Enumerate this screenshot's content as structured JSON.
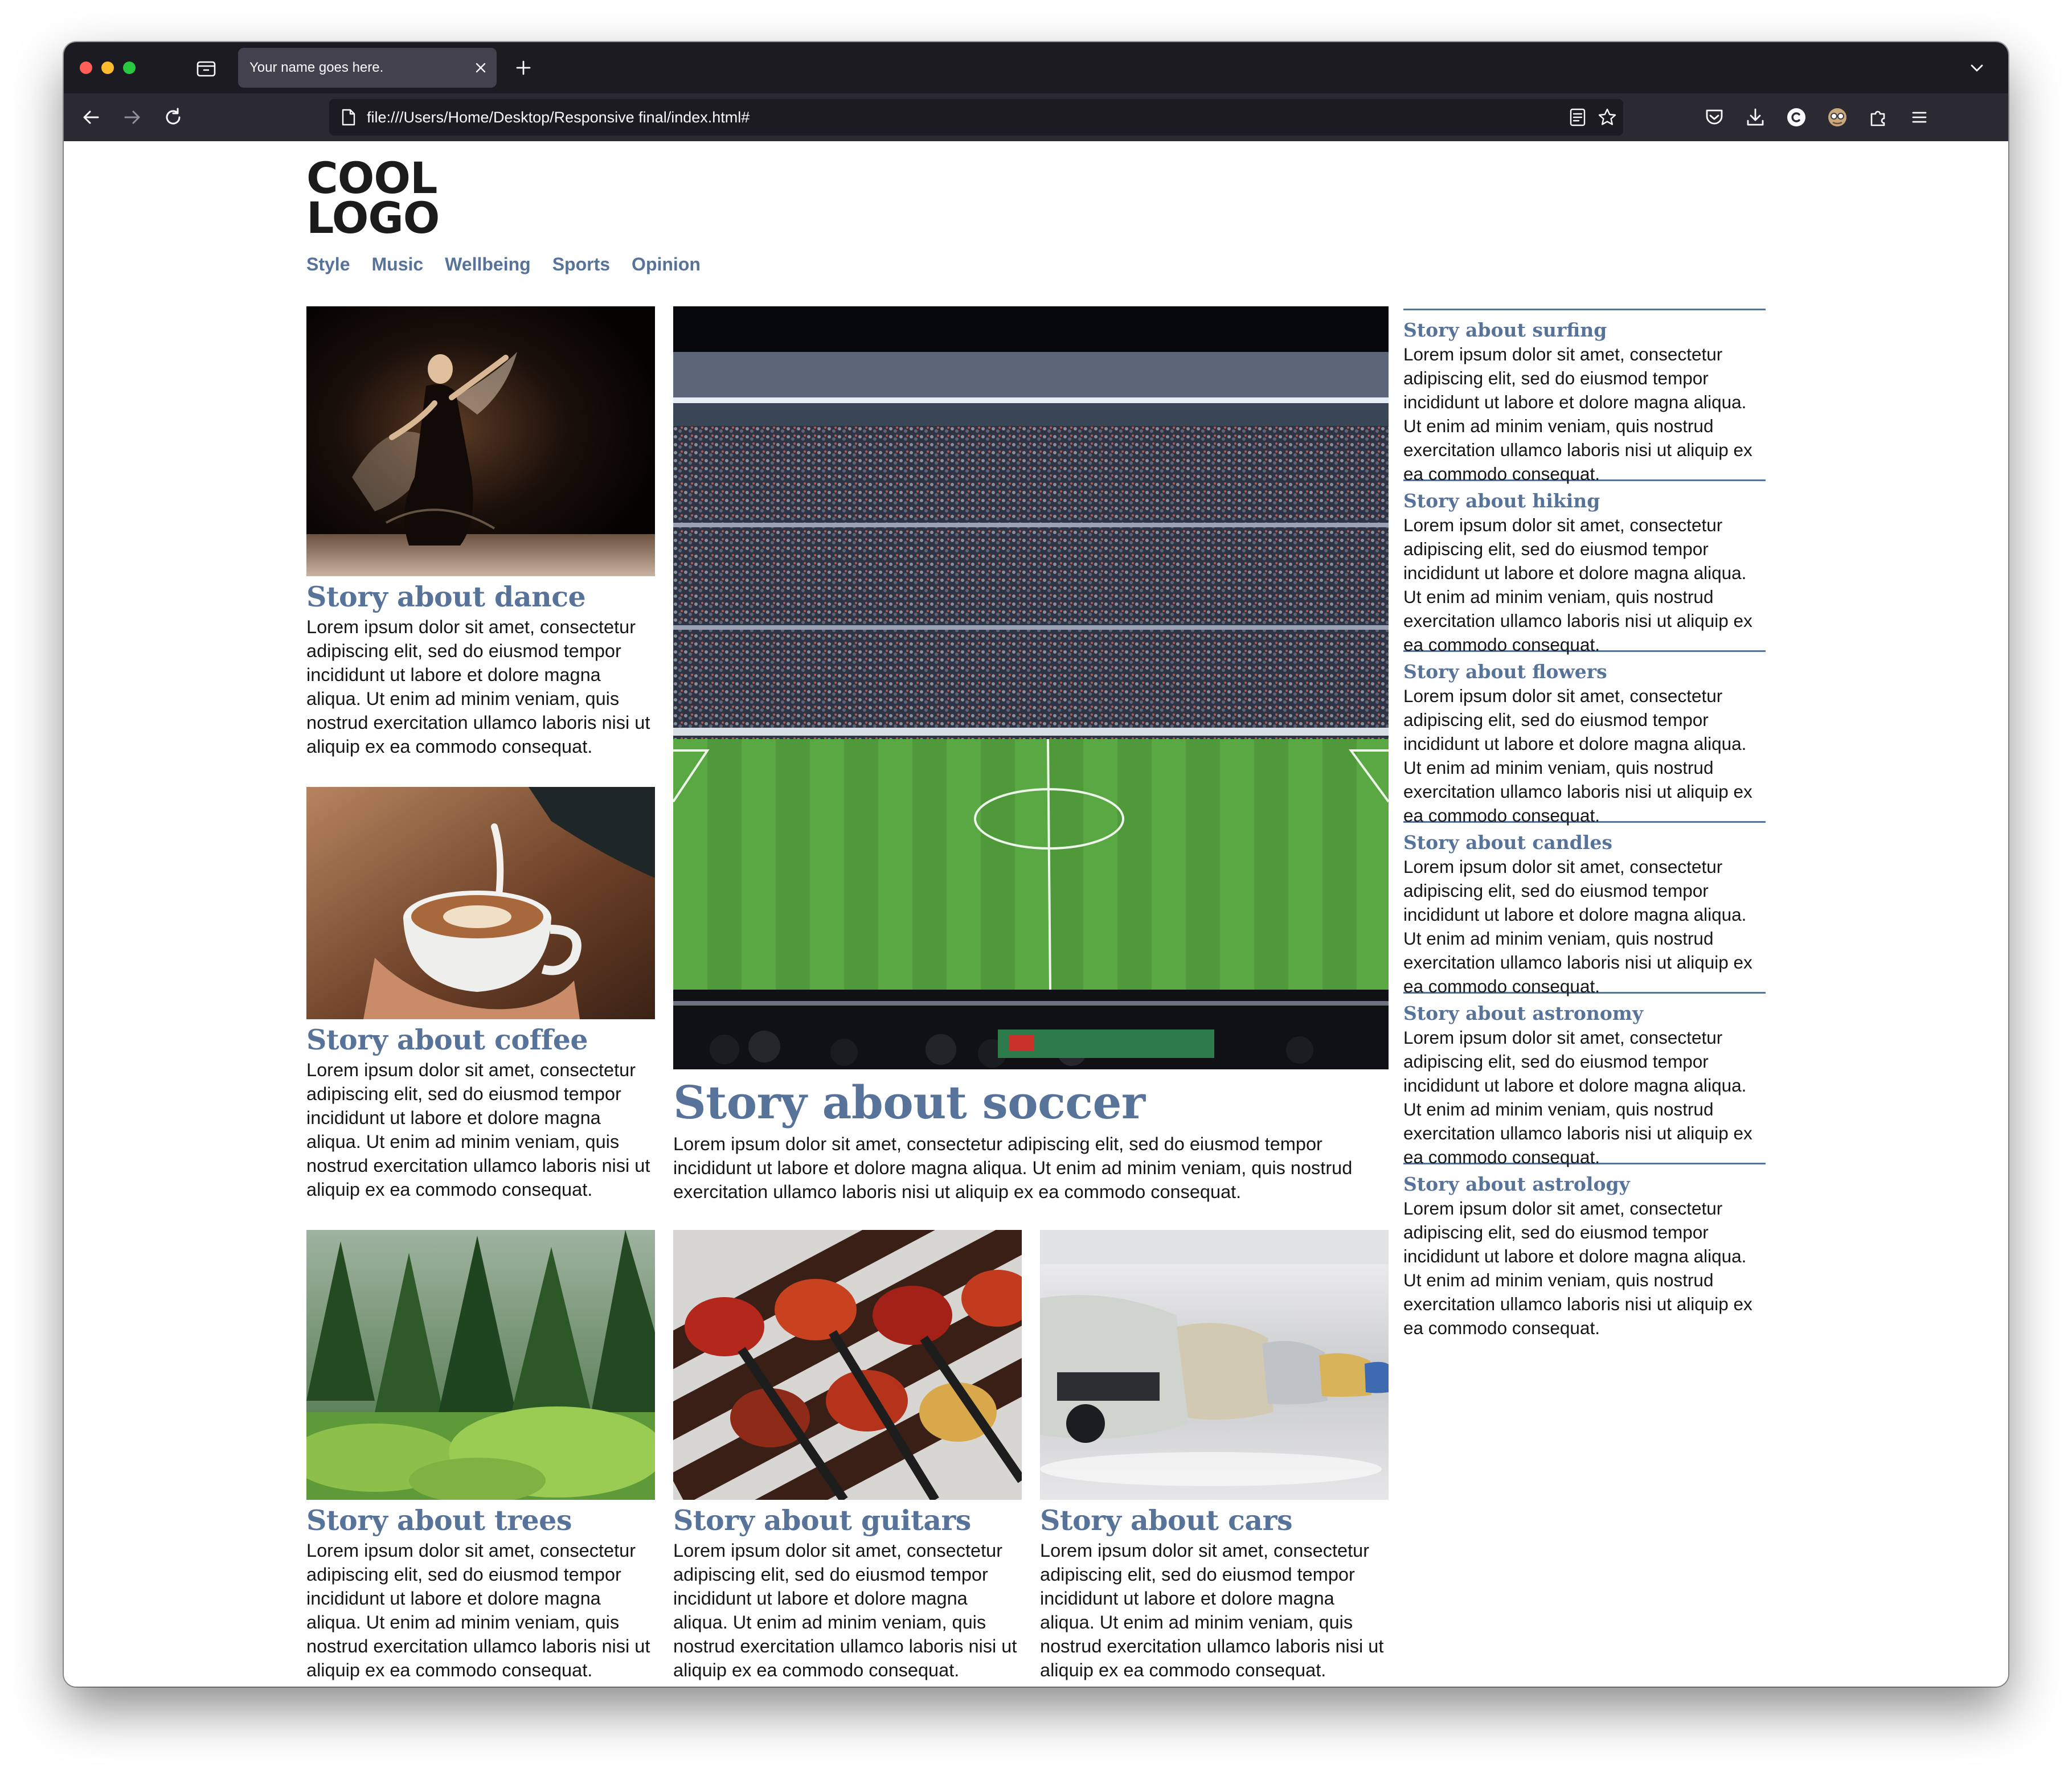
{
  "browser": {
    "tab_title": "Your name goes here.",
    "url": "file:///Users/Home/Desktop/Responsive final/index.html#"
  },
  "site": {
    "logo_line1": "COOL",
    "logo_line2": "LOGO",
    "nav": [
      "Style",
      "Music",
      "Wellbeing",
      "Sports",
      "Opinion"
    ]
  },
  "stories": {
    "dance": {
      "title": "Story about dance",
      "body": "Lorem ipsum dolor sit amet, consectetur adipiscing elit, sed do eiusmod tempor incididunt ut labore et dolore magna aliqua. Ut enim ad minim veniam, quis nostrud exercitation ullamco laboris nisi ut aliquip ex ea commodo consequat."
    },
    "coffee": {
      "title": "Story about coffee",
      "body": "Lorem ipsum dolor sit amet, consectetur adipiscing elit, sed do eiusmod tempor incididunt ut labore et dolore magna aliqua. Ut enim ad minim veniam, quis nostrud exercitation ullamco laboris nisi ut aliquip ex ea commodo consequat."
    },
    "soccer": {
      "title": "Story about soccer",
      "body": "Lorem ipsum dolor sit amet, consectetur adipiscing elit, sed do eiusmod tempor incididunt ut labore et dolore magna aliqua. Ut enim ad minim veniam, quis nostrud exercitation ullamco laboris nisi ut aliquip ex ea commodo consequat."
    },
    "trees": {
      "title": "Story about trees",
      "body": "Lorem ipsum dolor sit amet, consectetur adipiscing elit, sed do eiusmod tempor incididunt ut labore et dolore magna aliqua. Ut enim ad minim veniam, quis nostrud exercitation ullamco laboris nisi ut aliquip ex ea commodo consequat."
    },
    "guitars": {
      "title": "Story about guitars",
      "body": "Lorem ipsum dolor sit amet, consectetur adipiscing elit, sed do eiusmod tempor incididunt ut labore et dolore magna aliqua. Ut enim ad minim veniam, quis nostrud exercitation ullamco laboris nisi ut aliquip ex ea commodo consequat."
    },
    "cars": {
      "title": "Story about cars",
      "body": "Lorem ipsum dolor sit amet, consectetur adipiscing elit, sed do eiusmod tempor incididunt ut labore et dolore magna aliqua. Ut enim ad minim veniam, quis nostrud exercitation ullamco laboris nisi ut aliquip ex ea commodo consequat."
    }
  },
  "sidebar": [
    {
      "title": "Story about surfing",
      "body": "Lorem ipsum dolor sit amet, consectetur adipiscing elit, sed do eiusmod tempor incididunt ut labore et dolore magna aliqua. Ut enim ad minim veniam, quis nostrud exercitation ullamco laboris nisi ut aliquip ex ea commodo consequat."
    },
    {
      "title": "Story about hiking",
      "body": "Lorem ipsum dolor sit amet, consectetur adipiscing elit, sed do eiusmod tempor incididunt ut labore et dolore magna aliqua. Ut enim ad minim veniam, quis nostrud exercitation ullamco laboris nisi ut aliquip ex ea commodo consequat."
    },
    {
      "title": "Story about flowers",
      "body": "Lorem ipsum dolor sit amet, consectetur adipiscing elit, sed do eiusmod tempor incididunt ut labore et dolore magna aliqua. Ut enim ad minim veniam, quis nostrud exercitation ullamco laboris nisi ut aliquip ex ea commodo consequat."
    },
    {
      "title": "Story about candles",
      "body": "Lorem ipsum dolor sit amet, consectetur adipiscing elit, sed do eiusmod tempor incididunt ut labore et dolore magna aliqua. Ut enim ad minim veniam, quis nostrud exercitation ullamco laboris nisi ut aliquip ex ea commodo consequat."
    },
    {
      "title": "Story about astronomy",
      "body": "Lorem ipsum dolor sit amet, consectetur adipiscing elit, sed do eiusmod tempor incididunt ut labore et dolore magna aliqua. Ut enim ad minim veniam, quis nostrud exercitation ullamco laboris nisi ut aliquip ex ea commodo consequat."
    },
    {
      "title": "Story about astrology",
      "body": "Lorem ipsum dolor sit amet, consectetur adipiscing elit, sed do eiusmod tempor incididunt ut labore et dolore magna aliqua. Ut enim ad minim veniam, quis nostrud exercitation ullamco laboris nisi ut aliquip ex ea commodo consequat."
    }
  ],
  "colors": {
    "accent": "#587399",
    "tabbar": "#1c1b22",
    "toolbar": "#2b2a33",
    "tab_active": "#42414d"
  },
  "icons": [
    "tab-overview-icon",
    "close-icon",
    "plus-icon",
    "chevron-down-icon",
    "back-arrow-icon",
    "forward-arrow-icon",
    "reload-icon",
    "page-icon",
    "reader-view-icon",
    "bookmark-star-icon",
    "pocket-icon",
    "download-icon",
    "account-icon",
    "extension-avatar-icon",
    "extensions-puzzle-icon",
    "hamburger-menu-icon"
  ]
}
